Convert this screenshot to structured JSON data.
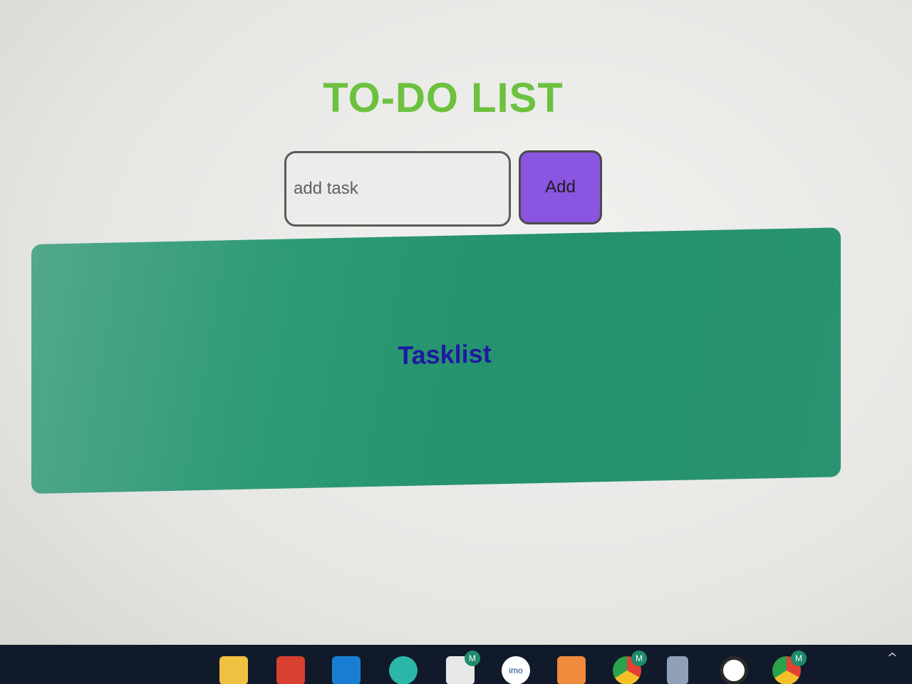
{
  "page": {
    "title": "TO-DO LIST",
    "input": {
      "placeholder": "add task",
      "value": ""
    },
    "add_button_label": "Add",
    "tasklist_label": "Tasklist"
  },
  "colors": {
    "title": "#6cc13e",
    "add_button": "#8a55e0",
    "panel": "#2e9a78",
    "tasklist_text": "#1e1aa0",
    "taskbar": "#101a2a"
  },
  "taskbar": {
    "icons": [
      {
        "name": "file-explorer-icon",
        "color": "#f0c040"
      },
      {
        "name": "app-red-icon",
        "color": "#d8412f"
      },
      {
        "name": "vscode-icon",
        "color": "#1a7fd4"
      },
      {
        "name": "edge-icon",
        "color": "#2bb6a8"
      },
      {
        "name": "app-badge-icon",
        "color": "#e8e8e8",
        "badge": "M"
      },
      {
        "name": "imo-icon",
        "color": "#ffffff",
        "text": "imo"
      },
      {
        "name": "app-orange-icon",
        "color": "#f08a3c"
      },
      {
        "name": "chrome-icon",
        "color": "#e34133",
        "badge": "M"
      },
      {
        "name": "calculator-icon",
        "color": "#8fa0b8"
      },
      {
        "name": "speedometer-icon",
        "color": "#ffffff"
      },
      {
        "name": "chrome-icon",
        "color": "#e34133",
        "badge": "M"
      }
    ],
    "tray_chevron": "^"
  }
}
